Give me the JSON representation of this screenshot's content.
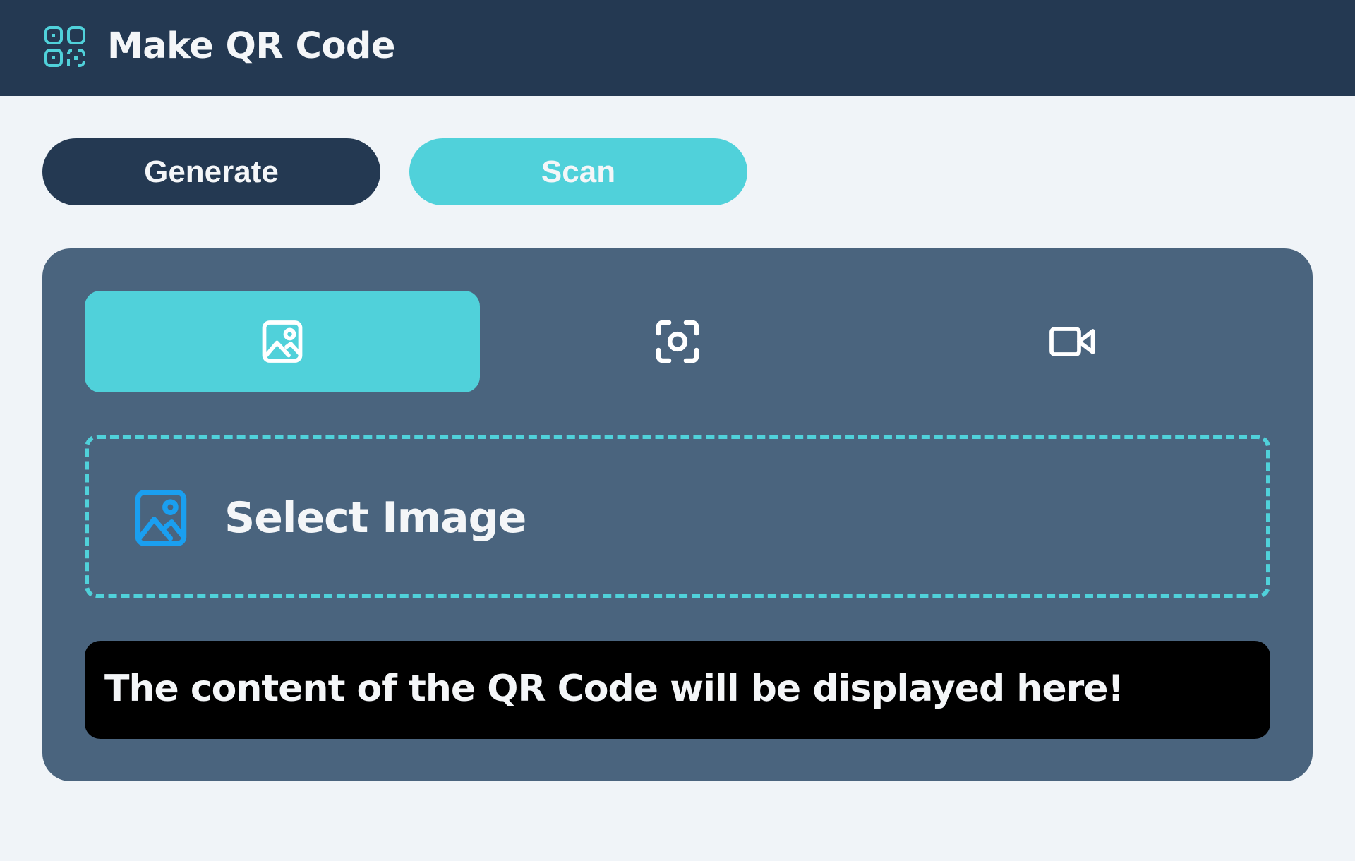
{
  "header": {
    "title": "Make QR Code",
    "logo_icon": "qr-code-icon"
  },
  "mode_buttons": {
    "generate_label": "Generate",
    "scan_label": "Scan",
    "active": "scan"
  },
  "scan_panel": {
    "tabs": [
      {
        "id": "image",
        "icon": "image-icon",
        "active": true
      },
      {
        "id": "camera-capture",
        "icon": "camera-focus-icon",
        "active": false
      },
      {
        "id": "video",
        "icon": "video-camera-icon",
        "active": false
      }
    ],
    "dropzone": {
      "icon": "image-icon",
      "label": "Select Image"
    },
    "output": {
      "text": "The content of the QR Code will be displayed here!"
    }
  },
  "colors": {
    "header_bg": "#243952",
    "accent": "#50d1da",
    "panel_bg": "#4a647e",
    "page_bg": "#f0f4f8",
    "output_bg": "#000000",
    "select_icon": "#1a9ff0"
  }
}
